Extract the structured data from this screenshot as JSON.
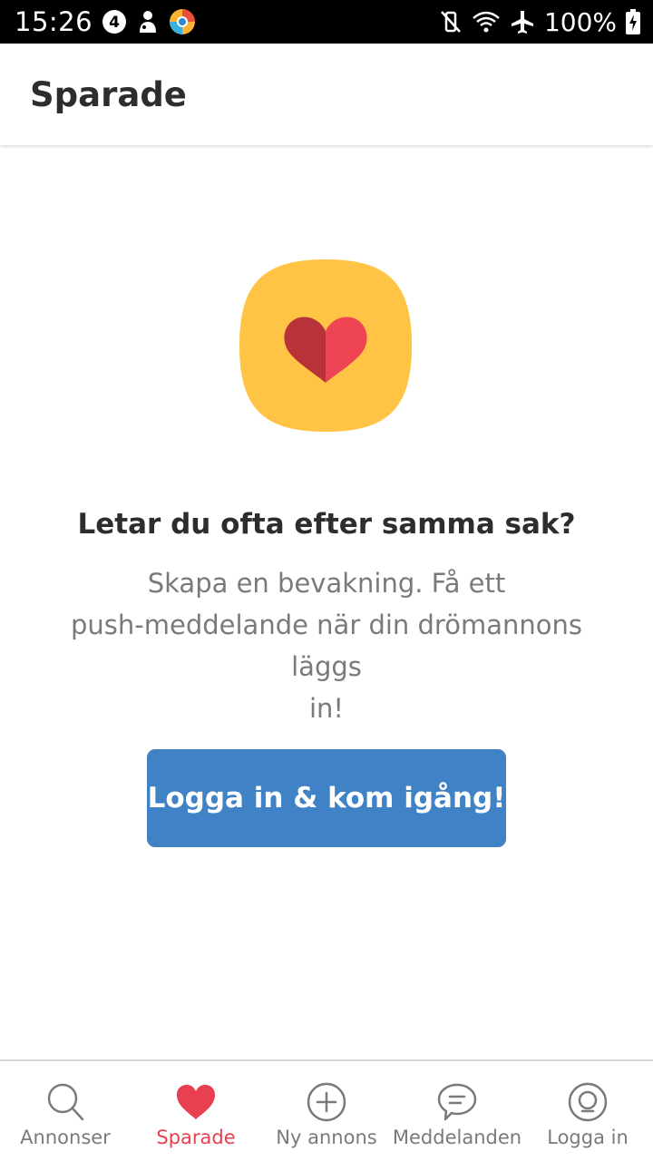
{
  "status_bar": {
    "time": "15:26",
    "battery": "100%"
  },
  "app_bar": {
    "title": "Sparade"
  },
  "empty_state": {
    "heading": "Letar du ofta efter samma sak?",
    "body_line1": "Skapa en bevakning. Få ett",
    "body_line2": "push-meddelande när din drömannons läggs",
    "body_line3": "in!",
    "cta_label": "Logga in & kom igång!",
    "illustration": "heart-icon"
  },
  "bottom_nav": {
    "items": [
      {
        "label": "Annonser",
        "icon": "search-icon"
      },
      {
        "label": "Sparade",
        "icon": "heart-icon",
        "active": true
      },
      {
        "label": "Ny annons",
        "icon": "plus-circle-icon"
      },
      {
        "label": "Meddelanden",
        "icon": "chat-bubble-icon"
      },
      {
        "label": "Logga in",
        "icon": "user-circle-icon"
      }
    ]
  },
  "colors": {
    "accent_blue": "#3f82c6",
    "active_red": "#e8404f",
    "illustration_yellow": "#ffc445"
  }
}
